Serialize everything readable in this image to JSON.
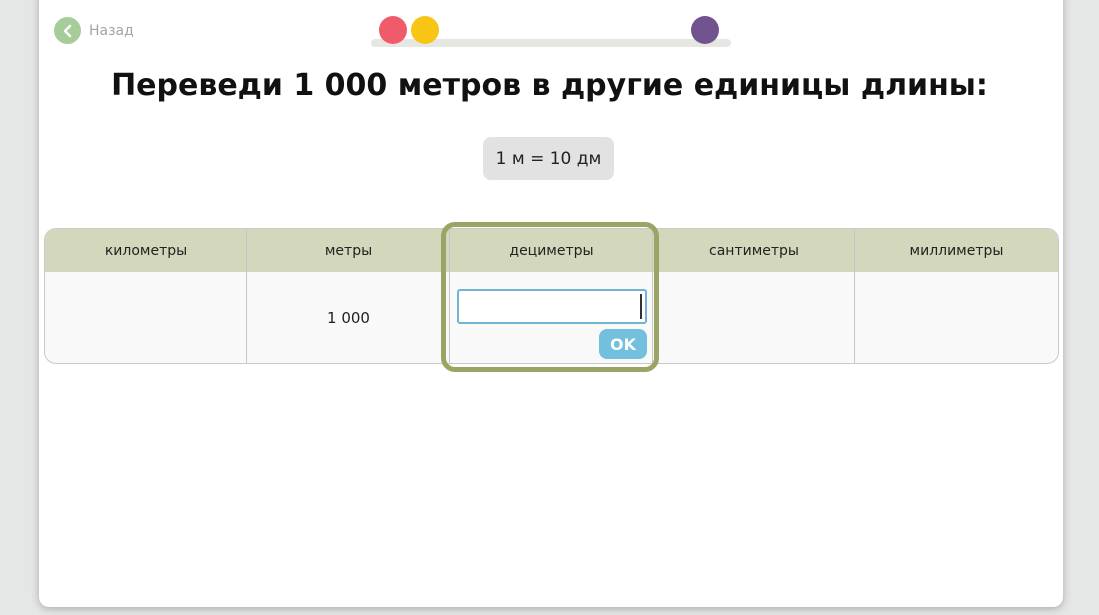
{
  "nav": {
    "back_label": "Назад"
  },
  "progress": {
    "colors": [
      "#ef5b68",
      "#f9c514",
      "#71548f"
    ]
  },
  "title": "Переведи 1 000 метров в другие единицы длины:",
  "hint": "1 м = 10 дм",
  "table": {
    "headers": [
      "километры",
      "метры",
      "дециметры",
      "сантиметры",
      "миллиметры"
    ],
    "row": [
      "",
      "1 000",
      "",
      "",
      ""
    ]
  },
  "answer": {
    "value": "",
    "ok_label": "OK"
  },
  "colors": {
    "header_bg": "#d3d8bd",
    "highlight": "#9aa465",
    "ok": "#72c0dd"
  }
}
